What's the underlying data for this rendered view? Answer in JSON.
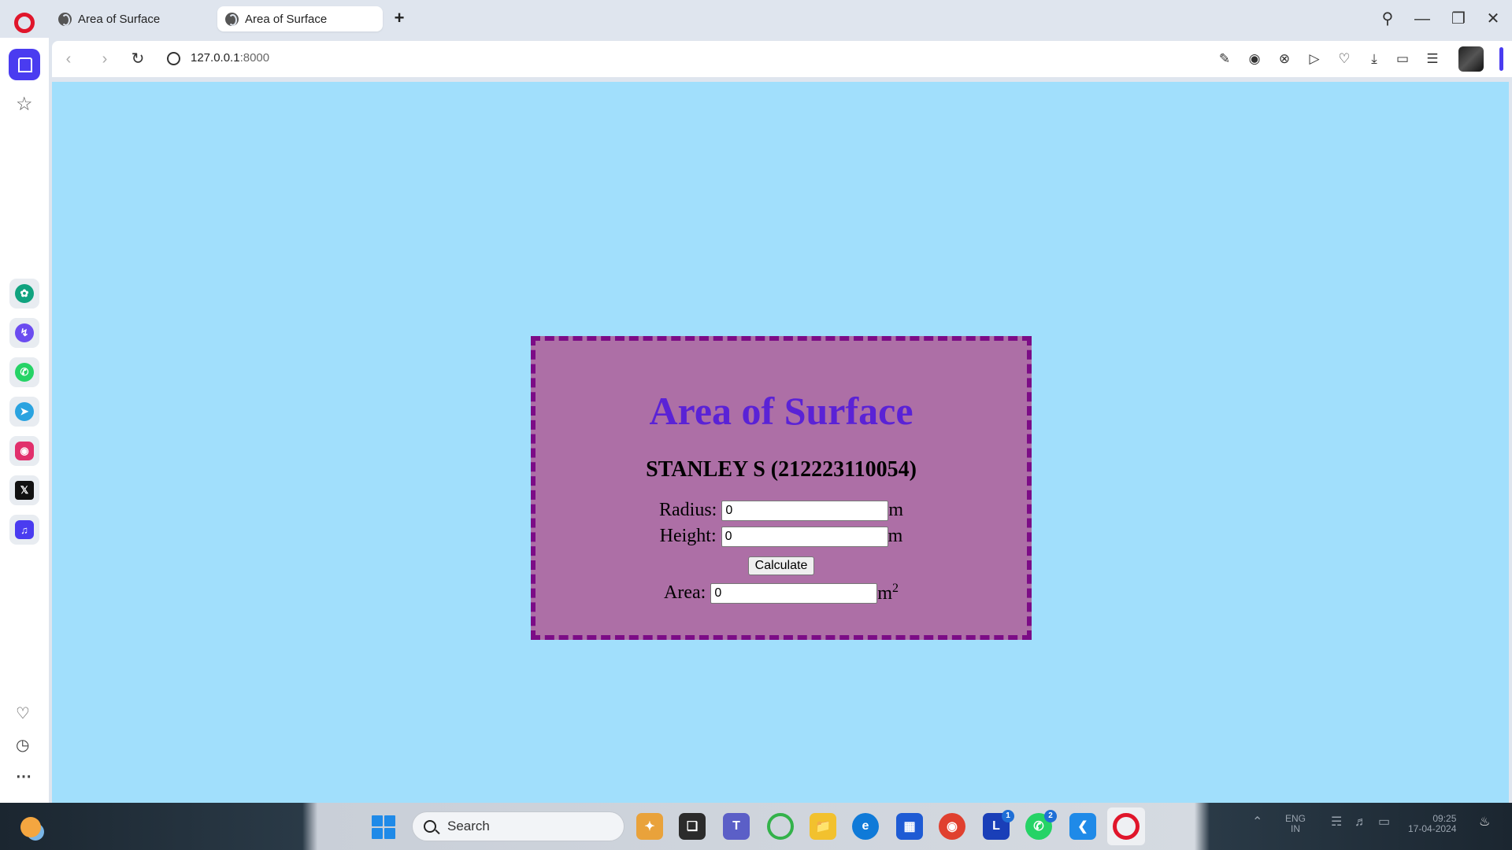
{
  "browser": {
    "tabs": [
      {
        "title": "Area of Surface",
        "active": false
      },
      {
        "title": "Area of Surface",
        "active": true
      }
    ],
    "new_tab_symbol": "+",
    "url_host": "127.0.0.1",
    "url_port": ":8000",
    "accent_color": "#4a3cf0"
  },
  "sidebar": {
    "apps": [
      {
        "name": "chatgpt-icon",
        "color": "#10a37f"
      },
      {
        "name": "messenger-icon",
        "color": "#6b4cf0"
      },
      {
        "name": "whatsapp-icon",
        "color": "#25d366"
      },
      {
        "name": "telegram-icon",
        "color": "#2aa3e0"
      },
      {
        "name": "instagram-icon",
        "color": "#e1306c"
      },
      {
        "name": "x-icon",
        "color": "#111111"
      },
      {
        "name": "music-icon",
        "color": "#4a3cf0"
      }
    ]
  },
  "page": {
    "title": "Area of Surface",
    "subtitle": "STANLEY S (212223110054)",
    "radius_label": "Radius:",
    "radius_value": "0",
    "radius_unit": "m",
    "height_label": "Height:",
    "height_value": "0",
    "height_unit": "m",
    "calculate_label": "Calculate",
    "area_label": "Area:",
    "area_value": "0",
    "area_unit": "m",
    "area_unit_exp": "2",
    "background_color": "#a1dffc",
    "card_color": "#ad6fa6",
    "title_color": "#5a22d6"
  },
  "taskbar": {
    "search_placeholder": "Search",
    "tray_lang_1": "ENG",
    "tray_lang_2": "IN",
    "time": "09:25",
    "date": "17-04-2024",
    "badges": {
      "l_app": "1",
      "whatsapp": "2"
    }
  }
}
